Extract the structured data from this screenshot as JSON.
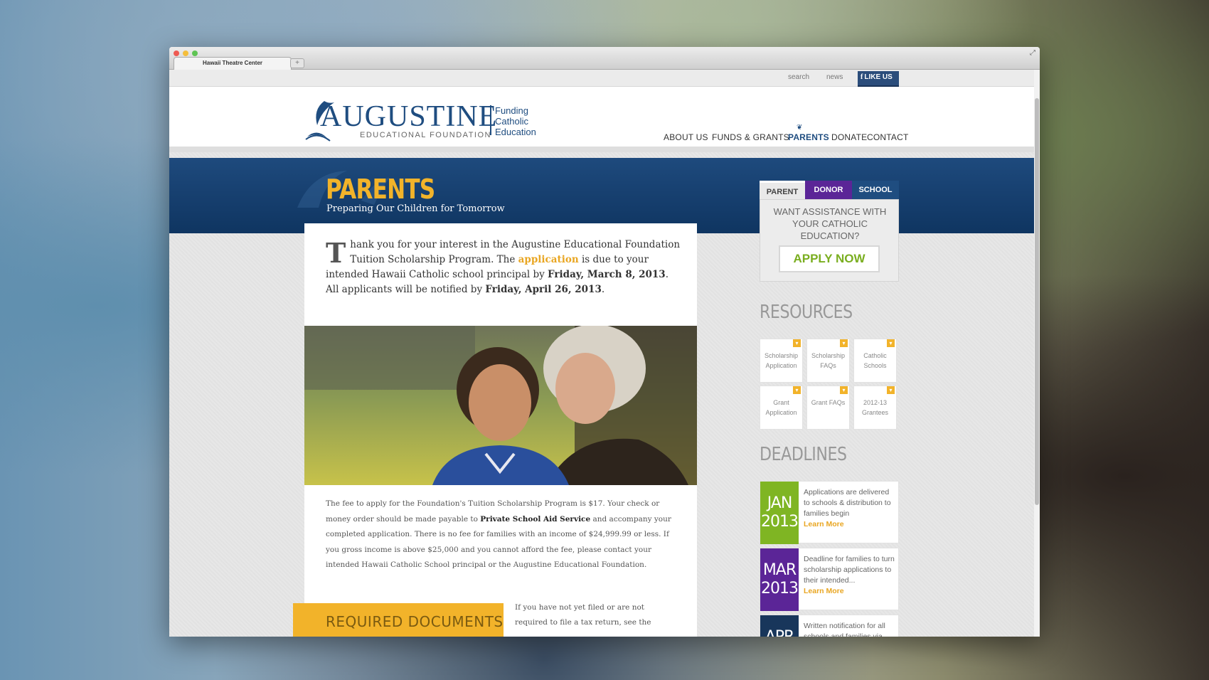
{
  "browser": {
    "tab_title": "Hawaii Theatre Center",
    "new_tab": "+"
  },
  "site": {
    "util": {
      "search": "search",
      "news": "news",
      "like": "LIKE US"
    },
    "logo": {
      "wordmark": "AUGUSTINE",
      "subtitle": "EDUCATIONAL FOUNDATION",
      "tagline_1": "Funding",
      "tagline_2": "Catholic",
      "tagline_3": "Education"
    },
    "nav": {
      "items": [
        "ABOUT US",
        "FUNDS & GRANTS",
        "PARENTS",
        "DONATE",
        "CONTACT"
      ],
      "active": "PARENTS"
    },
    "banner": {
      "title": "PARENTS",
      "subtitle": "Preparing Our Children for Tomorrow"
    },
    "content": {
      "dropcap": "T",
      "intro_1": "hank you for your interest in the Augustine Educational Foundation Tuition Scholarship Program. The ",
      "intro_link": "application",
      "intro_2": " is due to your intended Hawaii Catholic school principal by ",
      "intro_date1": "Friday, March 8, 2013",
      "intro_3": ".  All applicants will be notified by ",
      "intro_date2": "Friday, April 26, 2013",
      "intro_4": ".",
      "fee_1": "The fee to apply for the Foundation's Tuition Scholarship Program is $17.  Your check or money order should be made payable to ",
      "fee_bold": "Private School Aid Service",
      "fee_2": " and accompany your completed application.  There is no fee for families with an income of $24,999.99 or less.  If you gross income is above $25,000 and you cannot afford the fee, please contact your intended Hawaii Catholic School principal or the Augustine Educational Foundation.",
      "required_title": "REQUIRED DOCUMENTS",
      "tax_text": "If you have not yet filed or are not required to file a tax return, see the"
    },
    "sidebar": {
      "tabs": [
        "PARENT",
        "DONOR",
        "SCHOOL"
      ],
      "assist_text": "WANT ASSISTANCE WITH YOUR CATHOLIC EDUCATION?",
      "apply_label": "APPLY NOW",
      "resources_title": "RESOURCES",
      "resources": [
        "Scholarship Application",
        "Scholarship FAQs",
        "Catholic Schools",
        "Grant Application",
        "Grant FAQs",
        "2012-13 Grantees"
      ],
      "deadlines_title": "DEADLINES",
      "deadlines": [
        {
          "month": "JAN",
          "year": "2013",
          "color": "#7fb523",
          "text": "Applications are delivered to schools & distribution to families begin",
          "more": "Learn More"
        },
        {
          "month": "MAR",
          "year": "2013",
          "color": "#5b2597",
          "text": "Deadline for families to turn scholarship applications to their intended...",
          "more": "Learn More"
        },
        {
          "month": "APR",
          "year": "",
          "color": "#18365b",
          "text": "Written notification for all schools and families via",
          "more": ""
        }
      ]
    }
  },
  "colors": {
    "brand_navy": "#1f4d80",
    "accent_gold": "#f2b32a",
    "accent_green": "#7fb523",
    "accent_purple": "#5b2597"
  }
}
